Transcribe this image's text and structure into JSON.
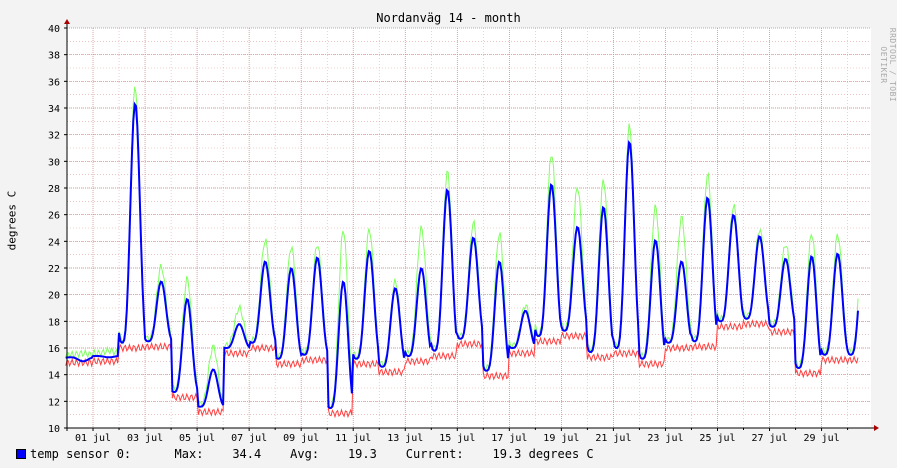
{
  "chart_data": {
    "type": "line",
    "title": "Nordanväg 14 - month",
    "ylabel": "degrees C",
    "watermark": "RRDTOOL / TOBI OETIKER",
    "xlabel": "",
    "x_ticks": [
      "01 jul",
      "03 jul",
      "05 jul",
      "07 jul",
      "09 jul",
      "11 jul",
      "13 jul",
      "15 jul",
      "17 jul",
      "19 jul",
      "21 jul",
      "23 jul",
      "25 jul",
      "27 jul",
      "29 jul"
    ],
    "y_ticks": [
      10,
      12,
      14,
      16,
      18,
      20,
      22,
      24,
      26,
      28,
      30,
      32,
      34,
      36,
      38,
      40
    ],
    "ylim": [
      10,
      40
    ],
    "xlim_days": [
      -1.0,
      29.9
    ],
    "grid": true,
    "colors": {
      "avg": "#0000ff",
      "max": "#80ff60",
      "min": "#ff4040",
      "grid": "#e0a0a0",
      "axis": "#000000",
      "arrow": "#aa0000",
      "plot_bg": "#ffffff"
    },
    "daily": [
      {
        "day": "30 jun",
        "min": 14.9,
        "avg": 15.0,
        "max": 15.6
      },
      {
        "day": "01 jul",
        "min": 15.0,
        "avg": 15.3,
        "max": 15.8
      },
      {
        "day": "02 jul",
        "min": 16.0,
        "avg": 34.4,
        "max": 35.6
      },
      {
        "day": "03 jul",
        "min": 16.1,
        "avg": 21.0,
        "max": 22.1
      },
      {
        "day": "04 jul",
        "min": 12.3,
        "avg": 19.7,
        "max": 21.2
      },
      {
        "day": "05 jul",
        "min": 11.2,
        "avg": 14.4,
        "max": 16.1
      },
      {
        "day": "06 jul",
        "min": 15.6,
        "avg": 17.8,
        "max": 19.0
      },
      {
        "day": "07 jul",
        "min": 16.0,
        "avg": 22.5,
        "max": 24.1
      },
      {
        "day": "08 jul",
        "min": 14.8,
        "avg": 22.0,
        "max": 23.6
      },
      {
        "day": "09 jul",
        "min": 15.1,
        "avg": 22.8,
        "max": 23.8
      },
      {
        "day": "10 jul",
        "min": 11.1,
        "avg": 21.0,
        "max": 24.9
      },
      {
        "day": "11 jul",
        "min": 14.8,
        "avg": 23.3,
        "max": 24.9
      },
      {
        "day": "12 jul",
        "min": 14.2,
        "avg": 20.5,
        "max": 21.0
      },
      {
        "day": "13 jul",
        "min": 15.0,
        "avg": 22.0,
        "max": 25.0
      },
      {
        "day": "14 jul",
        "min": 15.4,
        "avg": 27.9,
        "max": 29.2
      },
      {
        "day": "15 jul",
        "min": 16.3,
        "avg": 24.3,
        "max": 25.4
      },
      {
        "day": "16 jul",
        "min": 13.9,
        "avg": 22.5,
        "max": 24.6
      },
      {
        "day": "17 jul",
        "min": 15.6,
        "avg": 18.8,
        "max": 19.2
      },
      {
        "day": "18 jul",
        "min": 16.5,
        "avg": 28.3,
        "max": 30.6
      },
      {
        "day": "19 jul",
        "min": 16.9,
        "avg": 25.1,
        "max": 28.1
      },
      {
        "day": "20 jul",
        "min": 15.3,
        "avg": 26.6,
        "max": 28.6
      },
      {
        "day": "21 jul",
        "min": 15.6,
        "avg": 31.5,
        "max": 32.7
      },
      {
        "day": "22 jul",
        "min": 14.8,
        "avg": 24.1,
        "max": 26.6
      },
      {
        "day": "23 jul",
        "min": 16.0,
        "avg": 22.5,
        "max": 25.8
      },
      {
        "day": "24 jul",
        "min": 16.1,
        "avg": 27.3,
        "max": 29.0
      },
      {
        "day": "25 jul",
        "min": 17.6,
        "avg": 26.0,
        "max": 26.7
      },
      {
        "day": "26 jul",
        "min": 17.8,
        "avg": 24.4,
        "max": 24.9
      },
      {
        "day": "27 jul",
        "min": 17.2,
        "avg": 22.7,
        "max": 23.8
      },
      {
        "day": "28 jul",
        "min": 14.1,
        "avg": 22.9,
        "max": 24.6
      },
      {
        "day": "29 jul",
        "min": 15.1,
        "avg": 23.1,
        "max": 24.5
      }
    ]
  },
  "legend": {
    "label": "temp sensor 0:",
    "max_label": "Max:",
    "max_value": "34.4",
    "avg_label": "Avg:",
    "avg_value": "19.3",
    "current_label": "Current:",
    "current_value": "19.3",
    "unit": "degrees C"
  }
}
